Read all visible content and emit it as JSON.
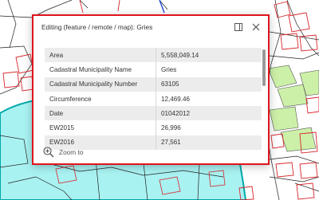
{
  "popup": {
    "title": "Editing (feature / remote / map): Gries",
    "zoom_label": "Zoom to",
    "attributes": [
      {
        "key": "Area",
        "value": "5,558,049.14"
      },
      {
        "key": "Cadastral Municipality Name",
        "value": "Gries"
      },
      {
        "key": "Cadastral Municipality Number",
        "value": "63105"
      },
      {
        "key": "Circumference",
        "value": "12,469.46"
      },
      {
        "key": "Date",
        "value": "01042012"
      },
      {
        "key": "EW2015",
        "value": "26,996"
      },
      {
        "key": "EW2016",
        "value": "27,561"
      }
    ]
  },
  "icons": {
    "maximize": "maximize-icon",
    "close": "close-icon",
    "zoom": "zoom-in-icon"
  },
  "colors": {
    "highlight_border": "#e0141c",
    "cadastral_fill": "#a9f2f2",
    "cadastral_border": "#00a8a8",
    "parcel_lines": "#d8262c",
    "green_parcels": "#ccf0a8"
  }
}
